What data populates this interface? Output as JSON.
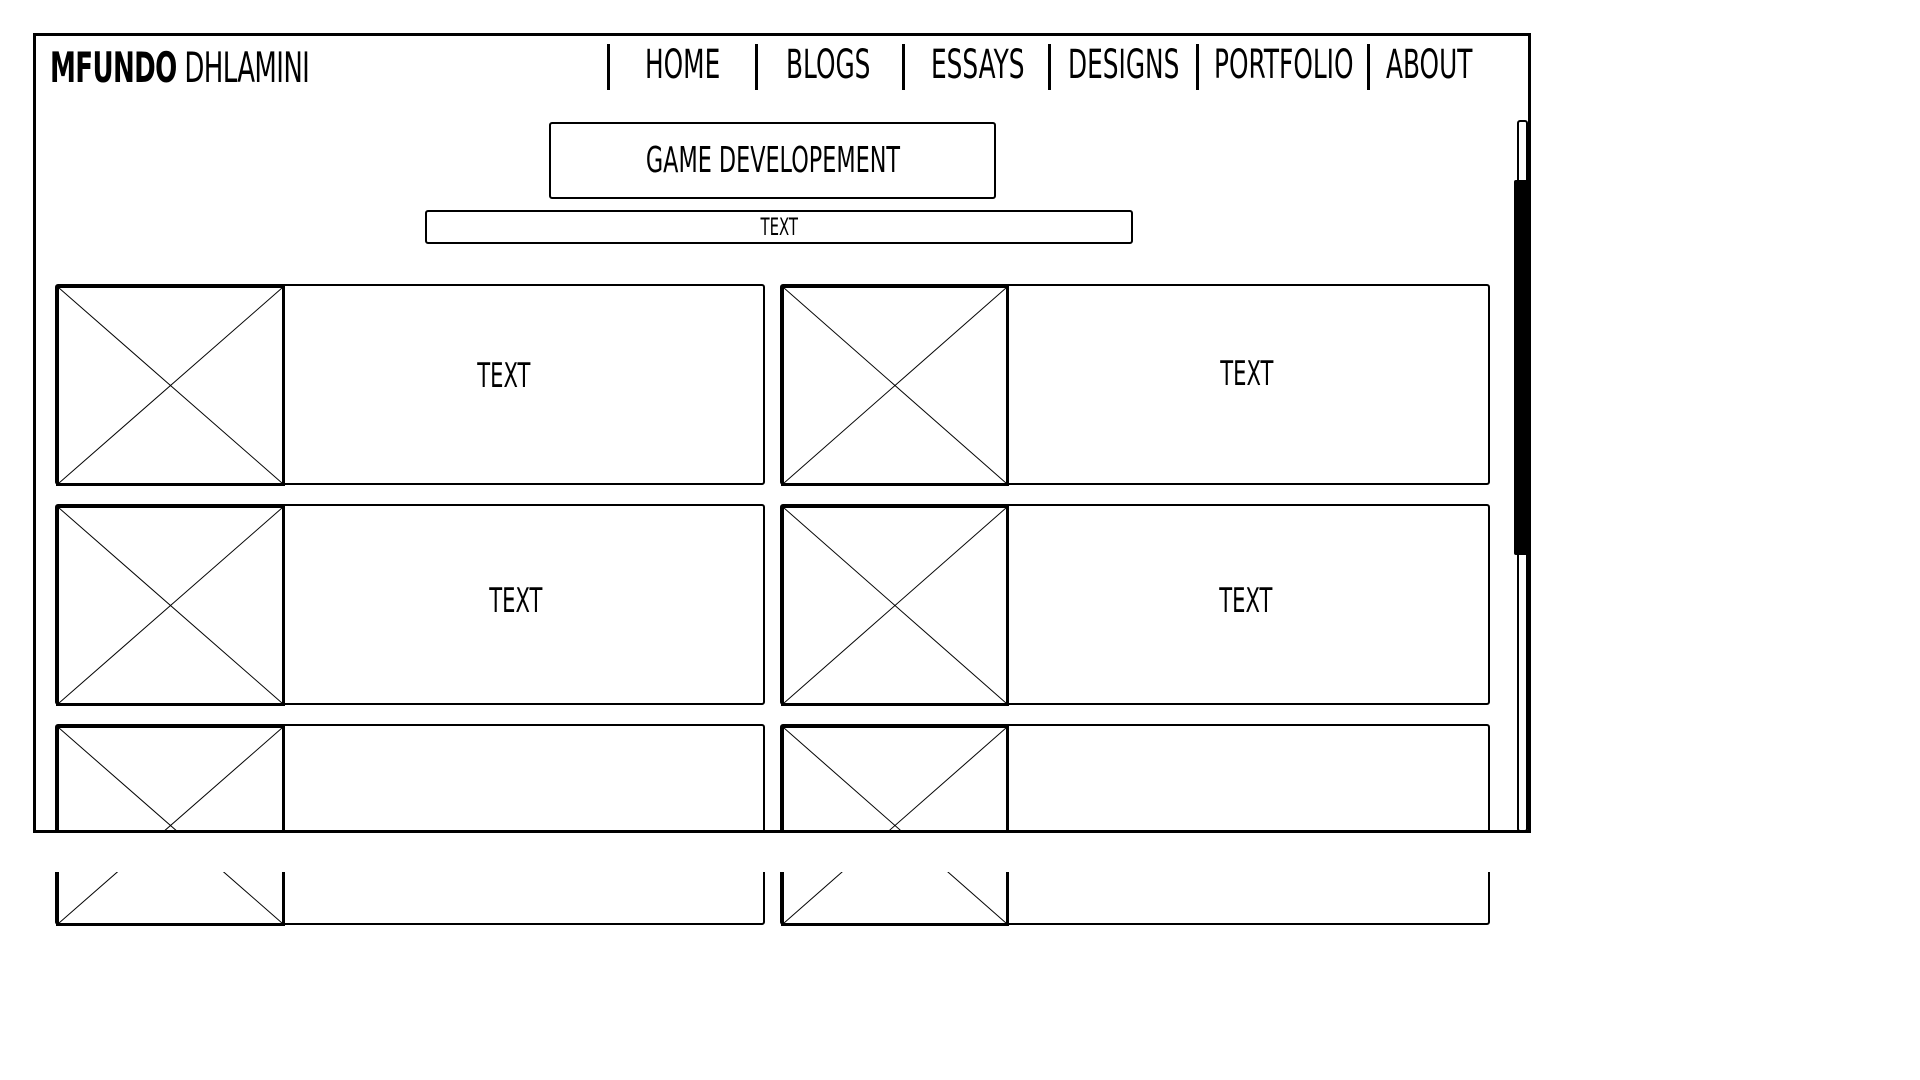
{
  "header": {
    "logo_first": "MFUNDO",
    "logo_last": "DHLAMINI"
  },
  "nav": {
    "items": [
      {
        "label": "HOME"
      },
      {
        "label": "BLOGS"
      },
      {
        "label": "ESSAYS"
      },
      {
        "label": "DESIGNS"
      },
      {
        "label": "PORTFOLIO"
      },
      {
        "label": "ABOUT"
      }
    ]
  },
  "main": {
    "title": "GAME DEVELOPEMENT",
    "subtitle": "TEXT",
    "cards": [
      {
        "text": "TEXT"
      },
      {
        "text": "TEXT"
      },
      {
        "text": "TEXT"
      },
      {
        "text": "TEXT"
      },
      {
        "text": ""
      },
      {
        "text": ""
      }
    ]
  },
  "colors": {
    "stroke": "#000000",
    "background": "#ffffff"
  },
  "icons": {
    "card_image": "image-placeholder-icon"
  }
}
